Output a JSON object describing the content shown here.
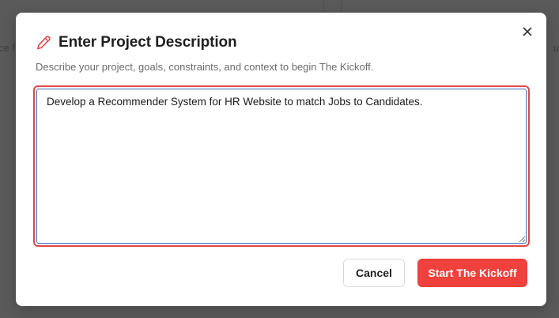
{
  "background": {
    "partial_text_left": "ce f",
    "partial_text_right": "ur"
  },
  "modal": {
    "title": "Enter Project Description",
    "title_icon": "pencil-icon",
    "subtitle": "Describe your project, goals, constraints, and context to begin The Kickoff.",
    "description_value": "Develop a Recommender System for HR Website to match Jobs to Candidates.",
    "close_icon": "close-icon",
    "cancel_label": "Cancel",
    "start_label": "Start The Kickoff"
  },
  "colors": {
    "accent": "#f0413c",
    "focus_ring": "#e0484e",
    "input_border": "#3e6fb7"
  }
}
